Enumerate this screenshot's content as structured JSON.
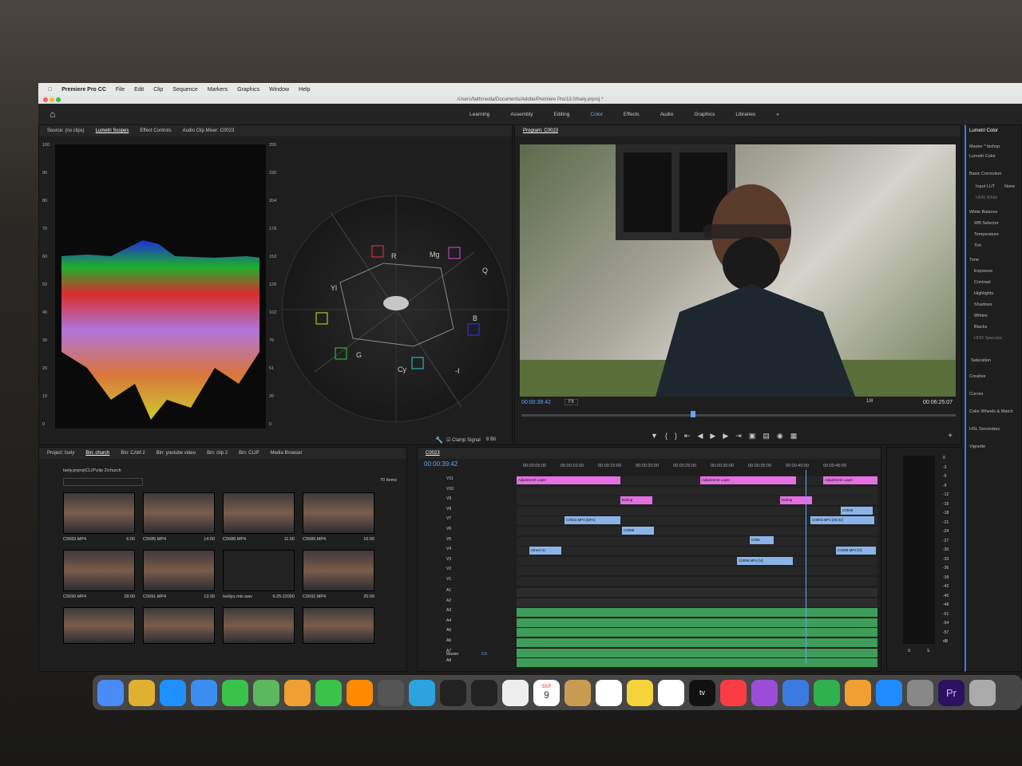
{
  "menubar": {
    "app": "Premiere Pro CC",
    "items": [
      "File",
      "Edit",
      "Clip",
      "Sequence",
      "Markers",
      "Graphics",
      "Window",
      "Help"
    ]
  },
  "titlebar": {
    "path": "/Users/faithmedia/Documents/Adobe/Premiere Pro/13.0/tsely.prproj *"
  },
  "workspaces": {
    "tabs": [
      "Learning",
      "Assembly",
      "Editing",
      "Color",
      "Effects",
      "Audio",
      "Graphics",
      "Libraries"
    ],
    "active": "Color",
    "more": "»"
  },
  "scopes": {
    "tabs": [
      "Source: (no clips)",
      "Lumetri Scopes",
      "Effect Controls",
      "Audio Clip Mixer: C0023"
    ],
    "left_axis": [
      "100",
      "90",
      "80",
      "70",
      "60",
      "50",
      "40",
      "30",
      "20",
      "10",
      "0"
    ],
    "right_axis": [
      "255",
      "230",
      "204",
      "178",
      "153",
      "128",
      "102",
      "76",
      "51",
      "26",
      "0"
    ],
    "vector_labels": [
      "R",
      "Mg",
      "B",
      "Cy",
      "G",
      "Yl",
      "Q",
      "-I"
    ],
    "clamp_signal": "Clamp Signal",
    "bit_depth": "8 Bit"
  },
  "program": {
    "title": "Program: C0023",
    "tc_current": "00:00:39:42",
    "fit": "Fit",
    "scale": "1/8",
    "tc_duration": "00:06:25:07"
  },
  "lumetri": {
    "title": "Lumetri Color",
    "master": "Master * bishop",
    "effect": "Lumetri Color",
    "basic": "Basic Correction",
    "input_lut": "Input LUT",
    "input_lut_val": "None",
    "hdr_white": "HDR White",
    "white_balance": "White Balance",
    "wb_selector": "WB Selector",
    "temperature": "Temperature",
    "tint": "Tint",
    "tone": "Tone",
    "exposure": "Exposure",
    "contrast": "Contrast",
    "highlights": "Highlights",
    "shadows": "Shadows",
    "whites": "Whites",
    "blacks": "Blacks",
    "hdr_specular": "HDR Specular",
    "saturation": "Saturation",
    "creative": "Creative",
    "curves": "Curves",
    "wheels": "Color Wheels & Match",
    "hsl": "HSL Secondary",
    "vignette": "Vignette"
  },
  "project": {
    "tabs": [
      "Project: tsely",
      "Bin: church",
      "Bin: CAM 2",
      "Bin: youtube video",
      "Bin: clip 2",
      "Bin: CLIP",
      "Media Browser"
    ],
    "path": "tsely.prproj\\CLIP\\clip 2\\church",
    "count": "70 Items",
    "items": [
      {
        "name": "C5683.MP4",
        "dur": "6:00"
      },
      {
        "name": "C5685.MP4",
        "dur": "14:00"
      },
      {
        "name": "C5688.MP4",
        "dur": "11:00"
      },
      {
        "name": "C5689.MP4",
        "dur": "16:00"
      },
      {
        "name": "C5690.MP4",
        "dur": "28:00"
      },
      {
        "name": "C5691.MP4",
        "dur": "13:30"
      },
      {
        "name": "tseliyu mix.wav",
        "dur": "6:25:22050"
      },
      {
        "name": "C5692.MP4",
        "dur": "25:00"
      }
    ]
  },
  "timeline": {
    "title": "C0023",
    "tc": "00:00:39:42",
    "ruler": [
      "00:00:05:00",
      "00:00:10:00",
      "00:00:15:00",
      "00:00:20:00",
      "00:00:25:00",
      "00:00:30:00",
      "00:00:35:00",
      "00:00:40:00",
      "00:00:45:00"
    ],
    "video_tracks": [
      "V11",
      "V10",
      "V9",
      "V8",
      "V7",
      "V6",
      "V5",
      "V4",
      "V3",
      "V2",
      "V1"
    ],
    "audio_tracks": [
      "A1",
      "A2",
      "A3",
      "A4",
      "A5",
      "A6",
      "A7",
      "A8"
    ],
    "master": "Master",
    "master_val": "0.0",
    "clips": {
      "adj": "Adjustment Layer",
      "bishop": "bishop",
      "c0022": "C0022.MP4 [60%]",
      "c0098": "C0098",
      "c0004": "C0004.MP4 [49.02]",
      "street": "Street Sc",
      "c0098b": "C0098.MP4 [V]",
      "c006": "C006",
      "c0048": "C0048",
      "c0098c": "C0098.MP4 [V]"
    }
  },
  "meter": {
    "labels": [
      "0",
      "-3",
      "-6",
      "-9",
      "-12",
      "-15",
      "-18",
      "-21",
      "-24",
      "-27",
      "-30",
      "-33",
      "-36",
      "-39",
      "-42",
      "-45",
      "-48",
      "-51",
      "-54",
      "-57",
      "dB"
    ],
    "s1": "S",
    "s2": "S"
  },
  "dock": {
    "apps": [
      "Finder",
      "Launchpad",
      "Safari",
      "Mail",
      "Messages",
      "Maps",
      "Photos",
      "FaceTime",
      "VLC",
      "Migration",
      "Telegram",
      "DaVinci",
      "CapCut",
      "Chrome",
      "Calendar",
      "Contacts",
      "Reminders",
      "Notes",
      "Freeform",
      "TV",
      "Music",
      "Podcasts",
      "Keynote",
      "Numbers",
      "Pages",
      "App Store",
      "System Settings",
      "Premiere",
      "QuickTime"
    ],
    "cal_month": "SEP",
    "cal_day": "9",
    "pr": "Pr",
    "tv": "tv"
  },
  "colors": {
    "accent": "#3b7be0",
    "clip_pink": "#e46fe0",
    "clip_blue": "#8ab4e8",
    "audio_green": "#3f9d5a"
  }
}
